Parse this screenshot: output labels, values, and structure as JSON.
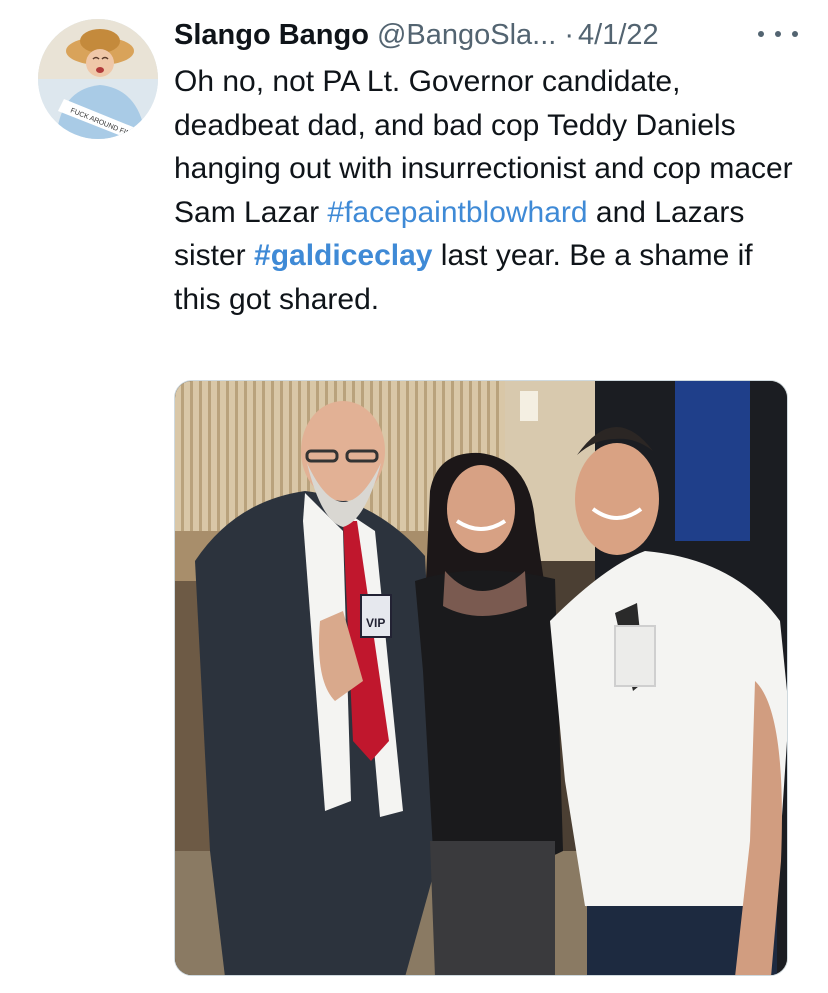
{
  "tweet": {
    "author": {
      "display_name": "Slango Bango",
      "handle": "@BangoSla...",
      "avatar_icon": "avatar-photo-icon",
      "avatar_sash_text": "FUCK AROUND FIND OUT"
    },
    "separator": "·",
    "date": "4/1/22",
    "more_icon": "more-dots-icon",
    "text": {
      "p1": "Oh no, not PA Lt. Governor candidate, deadbeat dad, and bad cop Teddy Daniels hanging out with insurrectionist and cop macer Sam Lazar ",
      "hashtag1": "#facepaintblowhard",
      "p2": " and Lazars sister ",
      "hashtag2": "#galdiceclay",
      "p3": " last year.  Be a shame if this got shared."
    },
    "photo": {
      "badge_text": "VIP",
      "colors": {
        "wall_stripes": "#d9c7a7",
        "curtain": "#1f3f8a",
        "tie": "#c0172d",
        "shirt_white": "#f4f4f2"
      }
    }
  }
}
